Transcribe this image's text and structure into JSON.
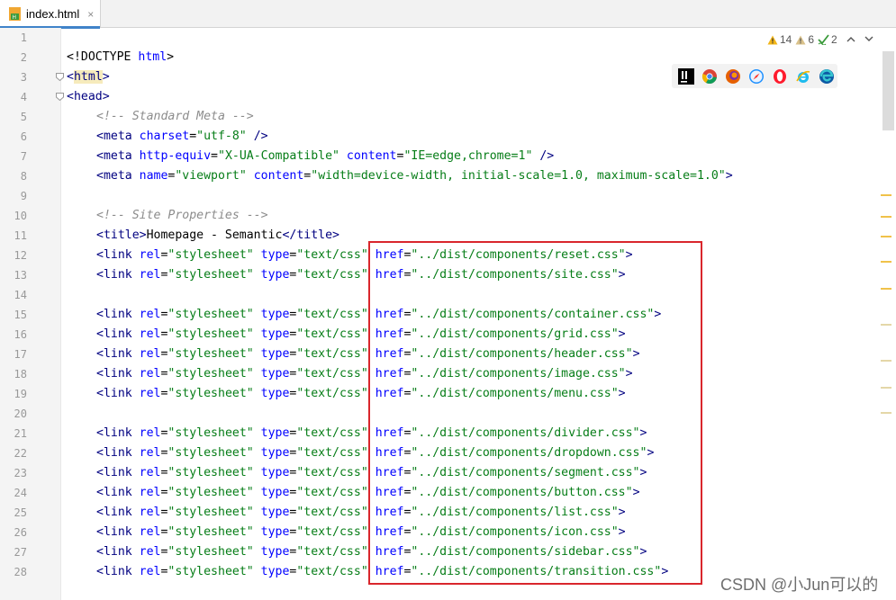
{
  "tab": {
    "filename": "index.html",
    "close": "×"
  },
  "inspections": {
    "warnings": "14",
    "weak_warnings": "6",
    "typos": "2"
  },
  "colors": {
    "tag": "#000080",
    "attr": "#0000ff",
    "value": "#067d17",
    "comment": "#8c8c8c",
    "highlight": "#d9262c"
  },
  "browsers": [
    "intellij-icon",
    "chrome-icon",
    "firefox-icon",
    "safari-icon",
    "opera-icon",
    "ie-icon",
    "edge-icon"
  ],
  "lines": [
    {
      "num": "1"
    },
    {
      "num": "2"
    },
    {
      "num": "3"
    },
    {
      "num": "4"
    },
    {
      "num": "5"
    },
    {
      "num": "6"
    },
    {
      "num": "7"
    },
    {
      "num": "8"
    },
    {
      "num": "9"
    },
    {
      "num": "10"
    },
    {
      "num": "11"
    },
    {
      "num": "12"
    },
    {
      "num": "13"
    },
    {
      "num": "14"
    },
    {
      "num": "15"
    },
    {
      "num": "16"
    },
    {
      "num": "17"
    },
    {
      "num": "18"
    },
    {
      "num": "19"
    },
    {
      "num": "20"
    },
    {
      "num": "21"
    },
    {
      "num": "22"
    },
    {
      "num": "23"
    },
    {
      "num": "24"
    },
    {
      "num": "25"
    },
    {
      "num": "26"
    },
    {
      "num": "27"
    },
    {
      "num": "28"
    }
  ],
  "code": {
    "doctype": "<!DOCTYPE ",
    "doctype_html": "html",
    "doctype_end": ">",
    "lt": "<",
    "gt": ">",
    "html_tag": "html",
    "head_tag": "head",
    "comment_meta": "<!-- Standard Meta -->",
    "meta": "<meta ",
    "charset_attr": "charset",
    "charset_val": "\"utf-8\"",
    "self_close": " />",
    "http_equiv_attr": "http-equiv",
    "http_equiv_val": "\"X-UA-Compatible\"",
    "content_attr": " content",
    "content_val_ie": "\"IE=edge,chrome=1\"",
    "name_attr": "name",
    "name_val": "\"viewport\"",
    "content_val_vp": "\"width=device-width, initial-scale=1.0, maximum-scale=1.0\"",
    "comment_site": "<!-- Site Properties -->",
    "title_open": "<title>",
    "title_text": "Homepage - Semantic",
    "title_close": "</title>",
    "link": "<link ",
    "rel_attr": "rel",
    "rel_val": "\"stylesheet\"",
    "type_attr": " type",
    "type_val": "\"text/css\"",
    "href_attr": " href",
    "eq": "="
  },
  "links": [
    {
      "line": 12,
      "href": "\"../dist/components/reset.css\""
    },
    {
      "line": 13,
      "href": "\"../dist/components/site.css\""
    },
    {
      "line": 15,
      "href": "\"../dist/components/container.css\""
    },
    {
      "line": 16,
      "href": "\"../dist/components/grid.css\""
    },
    {
      "line": 17,
      "href": "\"../dist/components/header.css\""
    },
    {
      "line": 18,
      "href": "\"../dist/components/image.css\""
    },
    {
      "line": 19,
      "href": "\"../dist/components/menu.css\""
    },
    {
      "line": 21,
      "href": "\"../dist/components/divider.css\""
    },
    {
      "line": 22,
      "href": "\"../dist/components/dropdown.css\""
    },
    {
      "line": 23,
      "href": "\"../dist/components/segment.css\""
    },
    {
      "line": 24,
      "href": "\"../dist/components/button.css\""
    },
    {
      "line": 25,
      "href": "\"../dist/components/list.css\""
    },
    {
      "line": 26,
      "href": "\"../dist/components/icon.css\""
    },
    {
      "line": 27,
      "href": "\"../dist/components/sidebar.css\""
    },
    {
      "line": 28,
      "href": "\"../dist/components/transition.css\""
    }
  ],
  "watermark": "CSDN @小Jun可以的"
}
